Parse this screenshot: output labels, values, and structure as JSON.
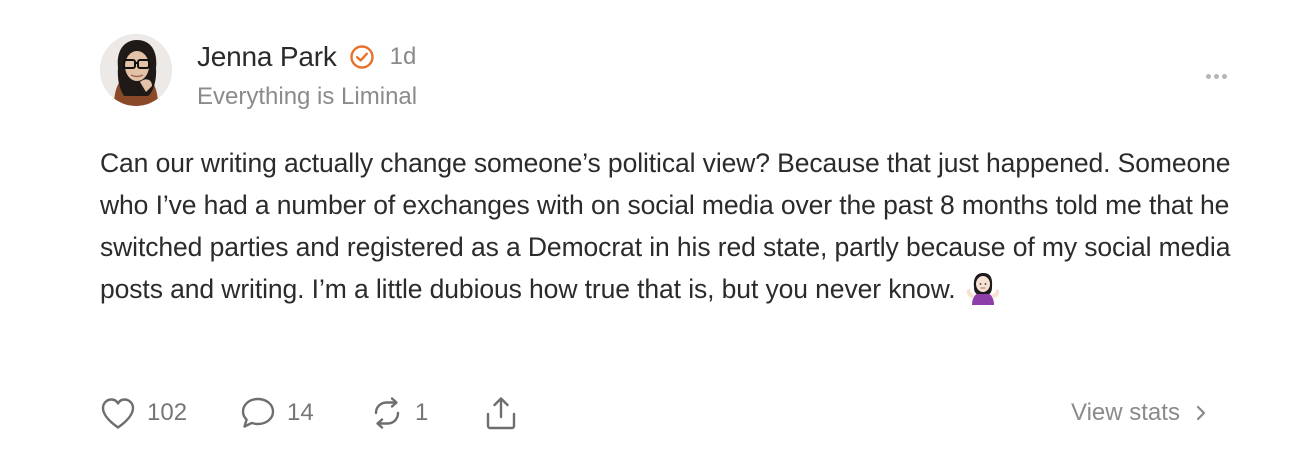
{
  "author": {
    "name": "Jenna Park",
    "verified_icon": "verified-badge-icon",
    "timestamp": "1d",
    "publication": "Everything is Liminal"
  },
  "post": {
    "text": "Can our writing actually change someone’s political view? Because that just happened. Someone who I’ve had a number of exchanges with on social media over the past 8 months told me that he switched parties and registered as a Democrat in his red state, partly because of my social media posts and writing. I’m a little dubious how true that is, but you never know.",
    "emoji": "woman-shrugging-emoji"
  },
  "actions": {
    "likes": "102",
    "comments": "14",
    "restacks": "1",
    "share_icon": "share-icon"
  },
  "stats": {
    "label": "View stats"
  },
  "colors": {
    "accent": "#e8712a",
    "text": "#2b2b2b",
    "muted": "#8a8a8a"
  }
}
